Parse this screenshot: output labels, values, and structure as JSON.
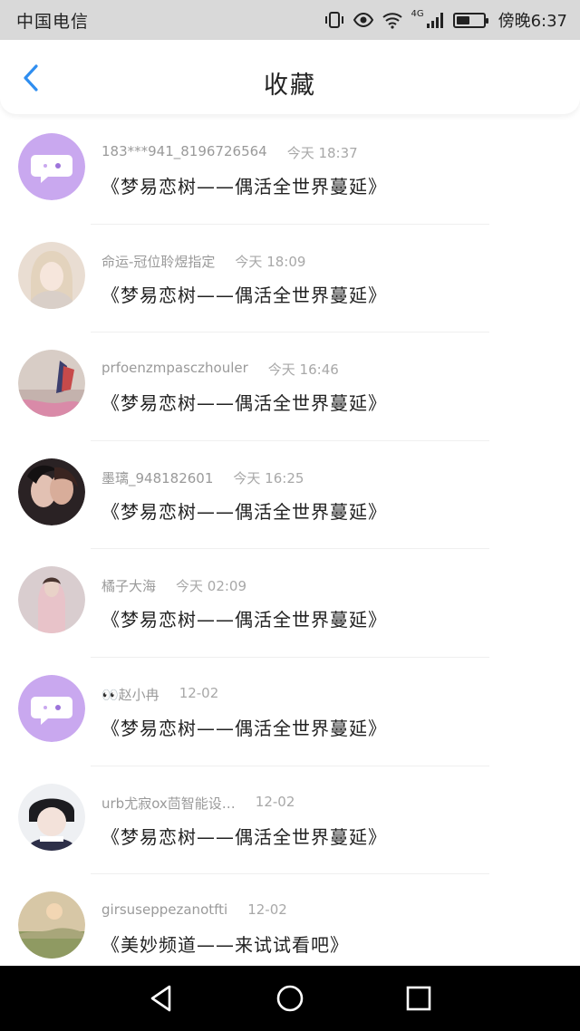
{
  "status_bar": {
    "carrier": "中国电信",
    "network": "4G",
    "time": "傍晚6:37",
    "battery_level": 0.5
  },
  "header": {
    "title": "收藏",
    "back_icon": "chevron-left-icon"
  },
  "colors": {
    "accent": "#2f8ef0",
    "default_avatar_bg": "#c9a8ef"
  },
  "items": [
    {
      "user": "183***941_8196726564",
      "time": "今天 18:37",
      "title": "《梦易恋树——偶活全世界蔓延》",
      "avatar": "default-chat-avatar"
    },
    {
      "user": "命运-冠位聆煜指定",
      "time": "今天 18:09",
      "title": "《梦易恋树——偶活全世界蔓延》",
      "avatar": "photo-avatar"
    },
    {
      "user": "prfoenzmpasczhouler",
      "time": "今天 16:46",
      "title": "《梦易恋树——偶活全世界蔓延》",
      "avatar": "photo-avatar"
    },
    {
      "user": "墨璃_948182601",
      "time": "今天 16:25",
      "title": "《梦易恋树——偶活全世界蔓延》",
      "avatar": "photo-avatar"
    },
    {
      "user": "橘子大海",
      "time": "今天 02:09",
      "title": "《梦易恋树——偶活全世界蔓延》",
      "avatar": "photo-avatar"
    },
    {
      "user": "👀赵小冉",
      "time": "12-02",
      "title": "《梦易恋树——偶活全世界蔓延》",
      "avatar": "default-chat-avatar"
    },
    {
      "user": "urb尤寂ox茴智能设…",
      "time": "12-02",
      "title": "《梦易恋树——偶活全世界蔓延》",
      "avatar": "photo-avatar"
    },
    {
      "user": "girsuseppezanotfti",
      "time": "12-02",
      "title": "《美妙频道——来试试看吧》",
      "avatar": "photo-avatar"
    }
  ],
  "nav_bar": {
    "back_icon": "triangle-back-icon",
    "home_icon": "circle-home-icon",
    "recents_icon": "square-recents-icon"
  }
}
